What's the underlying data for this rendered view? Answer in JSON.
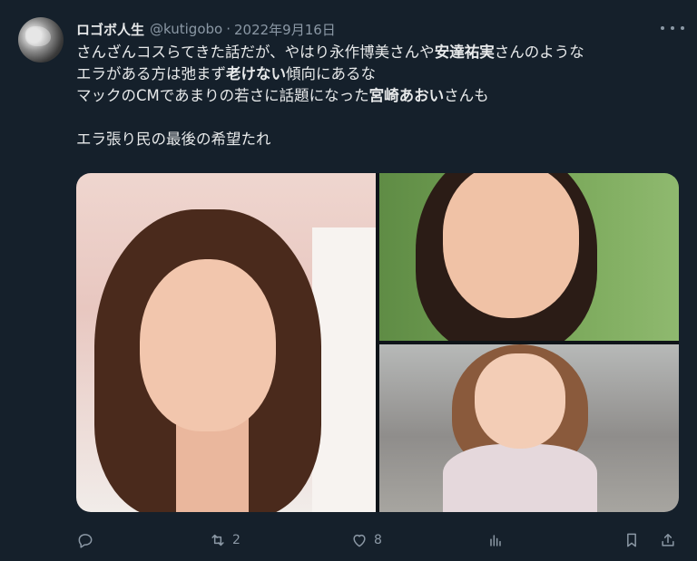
{
  "tweet": {
    "display_name": "ロゴボ人生",
    "handle": "@kutigobo",
    "separator": "·",
    "date": "2022年9月16日",
    "text": {
      "l1a": "さんざんコスらてきた話だが、やはり永作博美さんや",
      "l1b": "安達祐実",
      "l1c": "さんのような",
      "l2a": "エラがある方は弛まず",
      "l2b": "老けない",
      "l2c": "傾向にあるな",
      "l3a": "マックのCMであまりの若さに話題になった",
      "l3b": "宮崎あおい",
      "l3c": "さんも",
      "l5": "エラ張り民の最後の希望たれ"
    },
    "images": [
      "woman-with-shoulder-length-hair-smiling",
      "woman-smiling-with-earrings",
      "young-woman-pointing-outdoors"
    ]
  },
  "actions": {
    "reply_icon": "reply-icon",
    "retweet_icon": "retweet-icon",
    "retweet_count": "2",
    "like_icon": "heart-icon",
    "like_count": "8",
    "views_icon": "analytics-icon",
    "bookmark_icon": "bookmark-icon",
    "share_icon": "share-icon"
  },
  "colors": {
    "background": "#15202b",
    "text": "#e7e9ea",
    "secondary": "#8b98a5"
  }
}
